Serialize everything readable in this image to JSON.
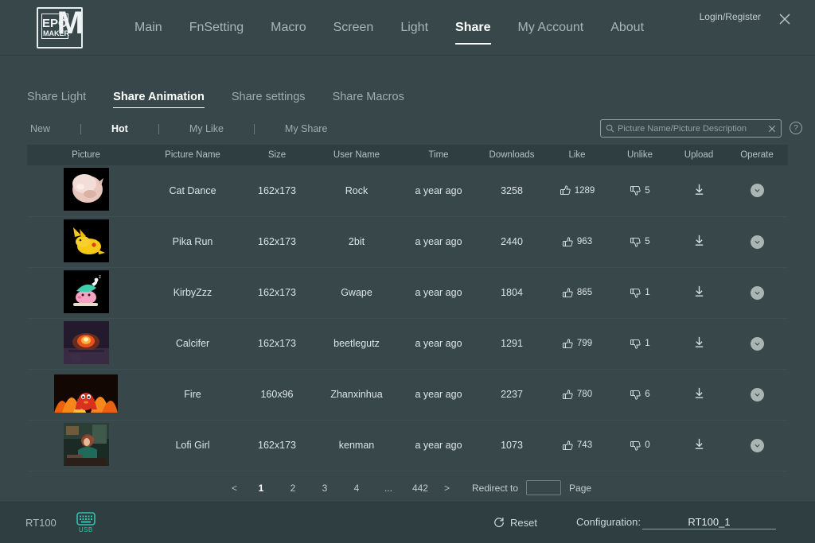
{
  "app": {
    "brand_line1": "EPO",
    "brand_line2": "MAKER",
    "brand_big": "M",
    "login_label": "Login/Register",
    "close_icon": "close-icon"
  },
  "main_nav": {
    "items": [
      {
        "label": "Main",
        "active": false
      },
      {
        "label": "FnSetting",
        "active": false
      },
      {
        "label": "Macro",
        "active": false
      },
      {
        "label": "Screen",
        "active": false
      },
      {
        "label": "Light",
        "active": false
      },
      {
        "label": "Share",
        "active": true
      },
      {
        "label": "My Account",
        "active": false
      },
      {
        "label": "About",
        "active": false
      }
    ]
  },
  "sub_nav": {
    "items": [
      {
        "label": "Share Light",
        "active": false
      },
      {
        "label": "Share Animation",
        "active": true
      },
      {
        "label": "Share settings",
        "active": false
      },
      {
        "label": "Share Macros",
        "active": false
      }
    ]
  },
  "filters": {
    "items": [
      {
        "label": "New",
        "active": false
      },
      {
        "label": "Hot",
        "active": true
      },
      {
        "label": "My Like",
        "active": false
      },
      {
        "label": "My Share",
        "active": false
      }
    ]
  },
  "search": {
    "placeholder": "Picture Name/Picture Description",
    "value": "",
    "search_icon": "search-icon",
    "clear_icon": "close-icon",
    "help_icon": "help-icon",
    "help_glyph": "?"
  },
  "table": {
    "columns": [
      "Picture",
      "Picture Name",
      "Size",
      "User Name",
      "Time",
      "Downloads",
      "Like",
      "Unlike",
      "Upload",
      "Operate"
    ],
    "rows": [
      {
        "picture": "cat-dance-thumbnail",
        "name": "Cat Dance",
        "size": "162x173",
        "user": "Rock",
        "time": "a year ago",
        "downloads": "3258",
        "like": "1289",
        "unlike": "5",
        "thumb_style": "std",
        "art": "cat"
      },
      {
        "picture": "pika-run-thumbnail",
        "name": "Pika Run",
        "size": "162x173",
        "user": "2bit",
        "time": "a year ago",
        "downloads": "2440",
        "like": "963",
        "unlike": "5",
        "thumb_style": "std",
        "art": "pika"
      },
      {
        "picture": "kirbyzzz-thumbnail",
        "name": "KirbyZzz",
        "size": "162x173",
        "user": "Gwape",
        "time": "a year ago",
        "downloads": "1804",
        "like": "865",
        "unlike": "1",
        "thumb_style": "std",
        "art": "kirby"
      },
      {
        "picture": "calcifer-thumbnail",
        "name": "Calcifer",
        "size": "162x173",
        "user": "beetlegutz",
        "time": "a year ago",
        "downloads": "1291",
        "like": "799",
        "unlike": "1",
        "thumb_style": "std",
        "art": "calcifer"
      },
      {
        "picture": "fire-thumbnail",
        "name": "Fire",
        "size": "160x96",
        "user": "Zhanxinhua",
        "time": "a year ago",
        "downloads": "2237",
        "like": "780",
        "unlike": "6",
        "thumb_style": "wide",
        "art": "fire"
      },
      {
        "picture": "lofi-girl-thumbnail",
        "name": "Lofi Girl",
        "size": "162x173",
        "user": "kenman",
        "time": "a year ago",
        "downloads": "1073",
        "like": "743",
        "unlike": "0",
        "thumb_style": "std",
        "art": "lofi"
      }
    ],
    "row_icons": {
      "like_icon": "thumbs-up-icon",
      "unlike_icon": "thumbs-down-icon",
      "upload_icon": "download-icon",
      "operate_icon": "chevron-down-circle-icon"
    }
  },
  "pagination": {
    "prev": "<",
    "next": ">",
    "pages": [
      "1",
      "2",
      "3",
      "4",
      "...",
      "442"
    ],
    "active_page": "1",
    "redirect_label": "Redirect to",
    "page_label": "Page",
    "page_value": ""
  },
  "footer": {
    "device": "RT100",
    "device_icon": "keyboard-icon",
    "connection": "USB",
    "reset_label": "Reset",
    "reset_icon": "refresh-icon",
    "configuration_label": "Configuration:",
    "configuration_value": "RT100_1"
  },
  "colors": {
    "background": "#37474a",
    "header_row": "#2f3e41",
    "footer": "#2f3e41",
    "accent_teal": "#2ec4b0",
    "text_primary": "#dde5e5",
    "text_muted": "#9fadae"
  }
}
